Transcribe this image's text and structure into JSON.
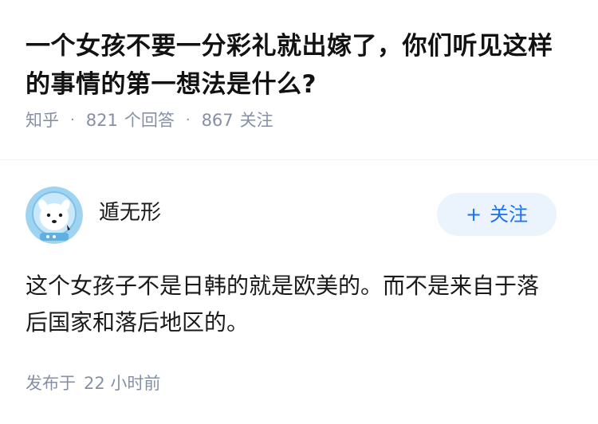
{
  "question": {
    "title": "一个女孩不要一分彩礼就出嫁了，你们听见这样的事情的第一想法是什么?",
    "source": "知乎",
    "answer_count": "821",
    "answer_label": "个回答",
    "follower_count": "867",
    "follower_label": "关注"
  },
  "answer": {
    "author_name": "遁无形",
    "avatar_icon": "cartoon-astronaut-avatar-icon",
    "follow_plus": "+",
    "follow_label": "关注",
    "content": "这个女孩子不是日韩的就是欧美的。而不是来自于落后国家和落后地区的。",
    "publish_label": "发布于",
    "publish_time": "22 小时前"
  },
  "colors": {
    "meta_gray": "#8590a6",
    "follow_blue": "#1772f6",
    "follow_bg": "#ebf3fc"
  }
}
